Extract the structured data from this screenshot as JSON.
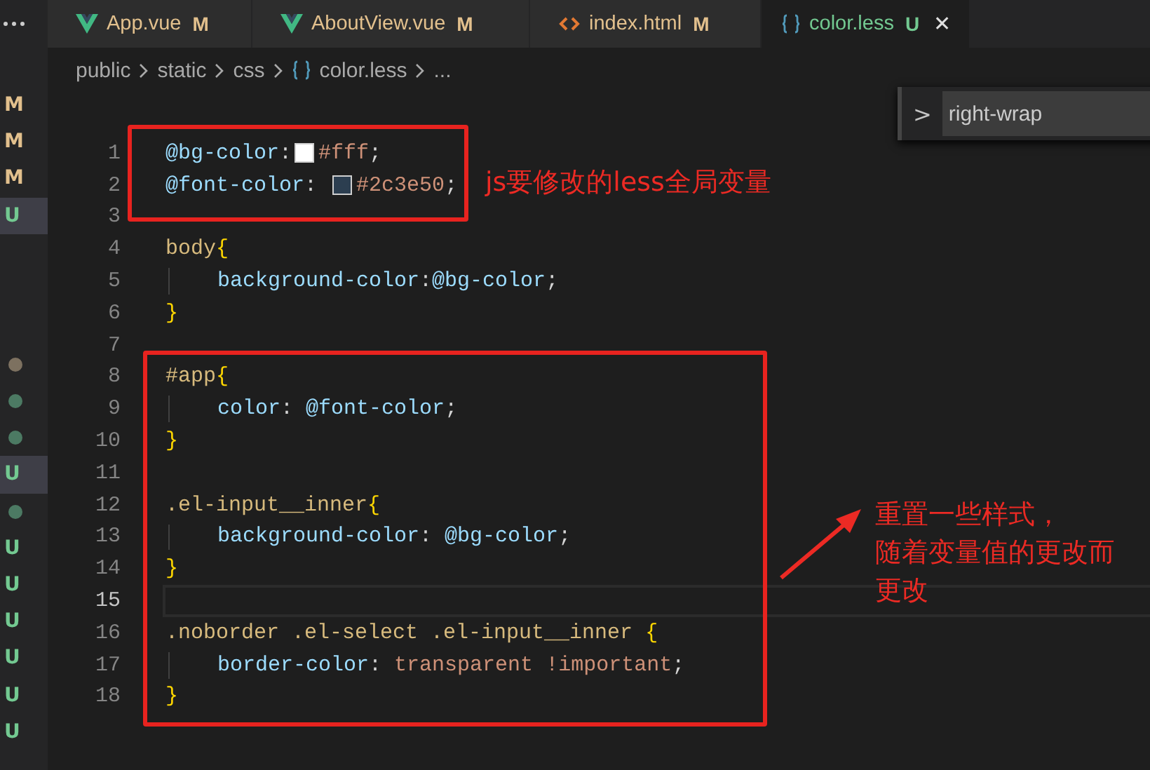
{
  "tabs": [
    {
      "kind": "vue",
      "label": "App.vue",
      "status": "M",
      "modified": true,
      "selected": false
    },
    {
      "kind": "vue",
      "label": "AboutView.vue",
      "status": "M",
      "modified": true,
      "selected": false
    },
    {
      "kind": "html",
      "label": "index.html",
      "status": "M",
      "modified": true,
      "selected": false
    },
    {
      "kind": "less",
      "label": "color.less",
      "status": "U",
      "modified": false,
      "selected": true,
      "close": "✕"
    }
  ],
  "breadcrumb": [
    {
      "kind": "folder",
      "label": "public"
    },
    {
      "kind": "folder",
      "label": "static"
    },
    {
      "kind": "folder",
      "label": "css"
    },
    {
      "kind": "less",
      "label": "color.less"
    },
    {
      "kind": "more",
      "label": "..."
    }
  ],
  "explorer_badges_top": [
    {
      "kind": "letter",
      "text": "M",
      "modified": true,
      "selected": false
    },
    {
      "kind": "letter",
      "text": "M",
      "modified": true,
      "selected": false
    },
    {
      "kind": "letter",
      "text": "M",
      "modified": true,
      "selected": false
    },
    {
      "kind": "letter",
      "text": "U",
      "modified": false,
      "selected": true
    }
  ],
  "explorer_badges_bottom": [
    {
      "kind": "dot",
      "color": "#7d7160",
      "selected": false
    },
    {
      "kind": "dot",
      "color": "#4c7a63",
      "selected": false
    },
    {
      "kind": "dot",
      "color": "#4c7a63",
      "selected": false
    },
    {
      "kind": "letter",
      "text": "U",
      "modified": false,
      "selected": true
    },
    {
      "kind": "dot",
      "color": "#4c7a63",
      "selected": false
    },
    {
      "kind": "letter",
      "text": "U",
      "modified": false,
      "selected": false
    },
    {
      "kind": "letter",
      "text": "U",
      "modified": false,
      "selected": false
    },
    {
      "kind": "letter",
      "text": "U",
      "modified": false,
      "selected": false
    },
    {
      "kind": "letter",
      "text": "U",
      "modified": false,
      "selected": false
    },
    {
      "kind": "letter",
      "text": "U",
      "modified": false,
      "selected": false
    },
    {
      "kind": "letter",
      "text": "U",
      "modified": false,
      "selected": false
    }
  ],
  "find_widget": {
    "toggle": ">",
    "value": "right-wrap"
  },
  "code_lines": [
    {
      "number": "1",
      "current": false,
      "indented": false,
      "tokens": [
        {
          "kind": "var",
          "text": "@bg-color"
        },
        {
          "kind": "punct",
          "text": ":"
        },
        {
          "kind": "swatch",
          "color": "#ffffff"
        },
        {
          "kind": "value",
          "text": "#fff"
        },
        {
          "kind": "punct",
          "text": ";"
        }
      ]
    },
    {
      "number": "2",
      "current": false,
      "indented": false,
      "tokens": [
        {
          "kind": "var",
          "text": "@font-color"
        },
        {
          "kind": "punct",
          "text": ": "
        },
        {
          "kind": "swatch",
          "color": "#2c3e50"
        },
        {
          "kind": "value",
          "text": "#2c3e50"
        },
        {
          "kind": "punct",
          "text": ";"
        }
      ]
    },
    {
      "number": "3",
      "current": false,
      "indented": false
    },
    {
      "number": "4",
      "current": false,
      "indented": false,
      "tokens": [
        {
          "kind": "selector",
          "text": "body"
        },
        {
          "kind": "brace",
          "text": "{"
        }
      ]
    },
    {
      "number": "5",
      "current": false,
      "indented": true,
      "tokens": [
        {
          "kind": "prop",
          "text": "background-color"
        },
        {
          "kind": "punct",
          "text": ":"
        },
        {
          "kind": "var",
          "text": "@bg-color"
        },
        {
          "kind": "punct",
          "text": ";"
        }
      ]
    },
    {
      "number": "6",
      "current": false,
      "indented": false,
      "tokens": [
        {
          "kind": "brace",
          "text": "}"
        }
      ]
    },
    {
      "number": "7",
      "current": false,
      "indented": false
    },
    {
      "number": "8",
      "current": false,
      "indented": false,
      "tokens": [
        {
          "kind": "selector",
          "text": "#app"
        },
        {
          "kind": "brace",
          "text": "{"
        }
      ]
    },
    {
      "number": "9",
      "current": false,
      "indented": true,
      "tokens": [
        {
          "kind": "prop",
          "text": "color"
        },
        {
          "kind": "punct",
          "text": ": "
        },
        {
          "kind": "var",
          "text": "@font-color"
        },
        {
          "kind": "punct",
          "text": ";"
        }
      ]
    },
    {
      "number": "10",
      "current": false,
      "indented": false,
      "tokens": [
        {
          "kind": "brace",
          "text": "}"
        }
      ]
    },
    {
      "number": "11",
      "current": false,
      "indented": false
    },
    {
      "number": "12",
      "current": false,
      "indented": false,
      "tokens": [
        {
          "kind": "selector",
          "text": ".el-input__inner"
        },
        {
          "kind": "brace",
          "text": "{"
        }
      ]
    },
    {
      "number": "13",
      "current": false,
      "indented": true,
      "tokens": [
        {
          "kind": "prop",
          "text": "background-color"
        },
        {
          "kind": "punct",
          "text": ": "
        },
        {
          "kind": "var",
          "text": "@bg-color"
        },
        {
          "kind": "punct",
          "text": ";"
        }
      ]
    },
    {
      "number": "14",
      "current": false,
      "indented": false,
      "tokens": [
        {
          "kind": "brace",
          "text": "}"
        }
      ]
    },
    {
      "number": "15",
      "current": true,
      "indented": false
    },
    {
      "number": "16",
      "current": false,
      "indented": false,
      "tokens": [
        {
          "kind": "selector",
          "text": ".noborder .el-select .el-input__inner "
        },
        {
          "kind": "brace",
          "text": "{"
        }
      ]
    },
    {
      "number": "17",
      "current": false,
      "indented": true,
      "tokens": [
        {
          "kind": "prop",
          "text": "border-color"
        },
        {
          "kind": "punct",
          "text": ": "
        },
        {
          "kind": "value",
          "text": "transparent !important"
        },
        {
          "kind": "punct",
          "text": ";"
        }
      ]
    },
    {
      "number": "18",
      "current": false,
      "indented": false,
      "tokens": [
        {
          "kind": "brace",
          "text": "}"
        }
      ]
    }
  ],
  "annotations": [
    {
      "kind": "box-note",
      "text": "js要修改的less全局变量"
    },
    {
      "kind": "arrow-note",
      "text": "重置一些样式，"
    },
    {
      "kind": "arrow-note-continued",
      "text": "随着变量值的更改而更改"
    }
  ]
}
